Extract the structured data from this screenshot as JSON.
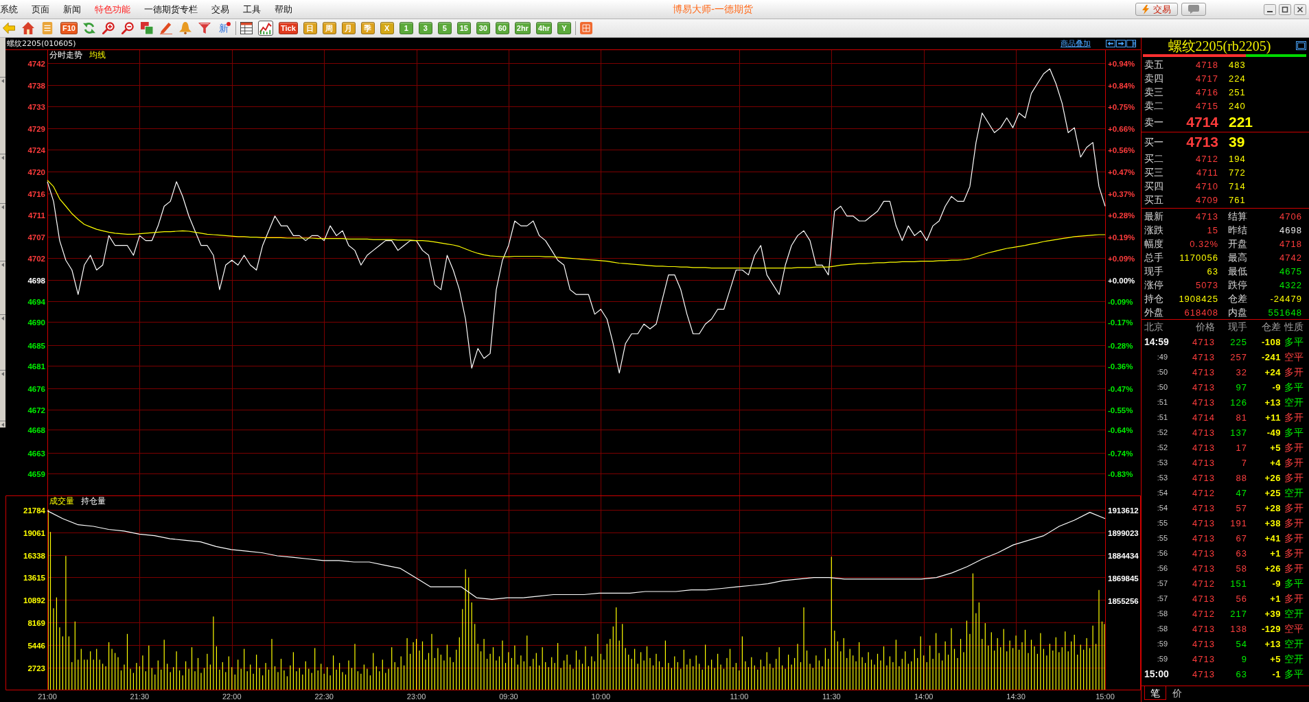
{
  "title_bar": {
    "menu": [
      {
        "label": "系统",
        "highlighted": false
      },
      {
        "label": "页面",
        "highlighted": false
      },
      {
        "label": "新闻",
        "highlighted": false
      },
      {
        "label": "特色功能",
        "highlighted": true
      },
      {
        "label": "一德期货专栏",
        "highlighted": false
      },
      {
        "label": "交易",
        "highlighted": false
      },
      {
        "label": "工具",
        "highlighted": false
      },
      {
        "label": "帮助",
        "highlighted": false
      }
    ],
    "title": "博易大师-一德期货",
    "buttons": [
      {
        "kind": "trade",
        "label": "交易"
      },
      {
        "kind": "chat"
      }
    ]
  },
  "toolbar": [
    {
      "kind": "icon",
      "selected": false
    },
    {
      "kind": "icon",
      "selected": false
    },
    {
      "kind": "icon",
      "selected": false
    },
    {
      "kind": "tile",
      "label": "F10",
      "color": "#e8581c",
      "selected": false
    },
    {
      "kind": "icon",
      "selected": false
    },
    {
      "kind": "icon",
      "selected": false
    },
    {
      "kind": "icon",
      "selected": false
    },
    {
      "kind": "icon",
      "selected": false
    },
    {
      "kind": "icon",
      "selected": false
    },
    {
      "kind": "icon",
      "selected": false
    },
    {
      "kind": "icon",
      "selected": false
    },
    {
      "kind": "news",
      "label": "新",
      "selected": false
    },
    {
      "kind": "separator"
    },
    {
      "kind": "icon",
      "selected": false
    },
    {
      "kind": "icon",
      "selected": true
    },
    {
      "kind": "tile",
      "label": "Tick",
      "color": "#e03a1e",
      "selected": false
    },
    {
      "kind": "tile",
      "label": "日",
      "color": "#dca21e",
      "selected": false
    },
    {
      "kind": "tile",
      "label": "周",
      "color": "#dca21e",
      "selected": false
    },
    {
      "kind": "tile",
      "label": "月",
      "color": "#dca21e",
      "selected": false
    },
    {
      "kind": "tile",
      "label": "季",
      "color": "#dca21e",
      "selected": false
    },
    {
      "kind": "tile",
      "label": "X",
      "color": "#d4a818",
      "selected": false
    },
    {
      "kind": "tile",
      "label": "1",
      "color": "#5caa3c",
      "selected": false
    },
    {
      "kind": "tile",
      "label": "3",
      "color": "#5caa3c",
      "selected": false
    },
    {
      "kind": "tile",
      "label": "5",
      "color": "#5caa3c",
      "selected": false
    },
    {
      "kind": "tile",
      "label": "15",
      "color": "#5caa3c",
      "selected": false
    },
    {
      "kind": "tile",
      "label": "30",
      "color": "#5caa3c",
      "selected": false
    },
    {
      "kind": "tile",
      "label": "60",
      "color": "#5caa3c",
      "selected": false
    },
    {
      "kind": "tile",
      "label": "2hr",
      "color": "#5caa3c",
      "selected": false
    },
    {
      "kind": "tile",
      "label": "4hr",
      "color": "#5caa3c",
      "selected": false
    },
    {
      "kind": "tile",
      "label": "Y",
      "color": "#5caa3c",
      "selected": false
    },
    {
      "kind": "separator"
    },
    {
      "kind": "icon",
      "selected": false
    }
  ],
  "chart_panel": {
    "instrument_label": "螺纹2205(010605)",
    "overlay_link": "商品叠加",
    "price_chart": {
      "percent_axis": [
        {
          "label": "+0.94%",
          "color": "#ff3c3c"
        },
        {
          "label": "+0.84%",
          "color": "#ff3c3c"
        },
        {
          "label": "+0.75%",
          "color": "#ff3c3c"
        },
        {
          "label": "+0.66%",
          "color": "#ff3c3c"
        },
        {
          "label": "+0.56%",
          "color": "#ff3c3c"
        },
        {
          "label": "+0.47%",
          "color": "#ff3c3c"
        },
        {
          "label": "+0.37%",
          "color": "#ff3c3c"
        },
        {
          "label": "+0.28%",
          "color": "#ff3c3c"
        },
        {
          "label": "+0.19%",
          "color": "#ff3c3c"
        },
        {
          "label": "+0.09%",
          "color": "#ff3c3c"
        },
        {
          "label": "+0.00%",
          "color": "#ffffff"
        },
        {
          "label": "-0.09%",
          "color": "#00ee00"
        },
        {
          "label": "-0.17%",
          "color": "#00ee00"
        },
        {
          "label": "-0.28%",
          "color": "#00ee00"
        },
        {
          "label": "-0.36%",
          "color": "#00ee00"
        },
        {
          "label": "-0.47%",
          "color": "#00ee00"
        },
        {
          "label": "-0.55%",
          "color": "#00ee00"
        },
        {
          "label": "-0.64%",
          "color": "#00ee00"
        },
        {
          "label": "-0.74%",
          "color": "#00ee00"
        },
        {
          "label": "-0.83%",
          "color": "#00ee00"
        }
      ],
      "chart_data": {
        "type": "line",
        "ylim": [
          4654.06,
          4744.96
        ],
        "grid": true,
        "yticks": [
          {
            "value": 4742.16,
            "label": "4742"
          },
          {
            "value": 4737.74,
            "label": "4738"
          },
          {
            "value": 4733.33,
            "label": "4733"
          },
          {
            "value": 4728.91,
            "label": "4729"
          },
          {
            "value": 4724.49,
            "label": "4724"
          },
          {
            "value": 4720.08,
            "label": "4720"
          },
          {
            "value": 4715.66,
            "label": "4716"
          },
          {
            "value": 4711.25,
            "label": "4711"
          },
          {
            "value": 4706.83,
            "label": "4707"
          },
          {
            "value": 4702.42,
            "label": "4702"
          },
          {
            "value": 4698,
            "label": "4698"
          },
          {
            "value": 4693.58,
            "label": "4694"
          },
          {
            "value": 4689.5,
            "label": "4690"
          },
          {
            "value": 4684.75,
            "label": "4685"
          },
          {
            "value": 4680.5,
            "label": "4681"
          },
          {
            "value": 4675.92,
            "label": "4676"
          },
          {
            "value": 4671.51,
            "label": "4672"
          },
          {
            "value": 4667.5,
            "label": "4668"
          },
          {
            "value": 4662.67,
            "label": "4663"
          },
          {
            "value": 4658.5,
            "label": "4659"
          }
        ],
        "series": [
          {
            "name": "分时走势",
            "color": "#ffffff",
            "values": [
              4718,
              4714,
              4706,
              4702,
              4700,
              4695,
              4701,
              4703,
              4700,
              4701,
              4707,
              4705,
              4705,
              4705,
              4703,
              4707,
              4706,
              4706,
              4709,
              4713,
              4714,
              4718,
              4715,
              4711,
              4708,
              4705,
              4705,
              4703,
              4696,
              4701,
              4702,
              4701,
              4703,
              4701,
              4700,
              4705,
              4708,
              4711,
              4709,
              4709,
              4707,
              4707,
              4706,
              4707,
              4707,
              4706,
              4709,
              4707,
              4708,
              4705,
              4704,
              4701,
              4703,
              4704,
              4705,
              4706,
              4706,
              4704,
              4705,
              4706,
              4706,
              4704,
              4703,
              4697,
              4696,
              4703,
              4700,
              4696,
              4690,
              4680,
              4684,
              4682,
              4683,
              4696,
              4702,
              4705,
              4710,
              4709,
              4709,
              4710,
              4707,
              4706,
              4704,
              4702,
              4701,
              4696,
              4695,
              4695,
              4695,
              4691,
              4692,
              4690,
              4685,
              4679,
              4685,
              4687,
              4687,
              4689,
              4688,
              4689,
              4694,
              4699,
              4699,
              4696,
              4691,
              4687,
              4687,
              4689,
              4690,
              4692,
              4692,
              4696,
              4700,
              4700,
              4699,
              4703,
              4705,
              4699,
              4697,
              4695,
              4701,
              4705,
              4707,
              4708,
              4706,
              4701,
              4701,
              4699,
              4712,
              4713,
              4711,
              4711,
              4710,
              4710,
              4711,
              4712,
              4714,
              4714,
              4709,
              4706,
              4709,
              4707,
              4708,
              4706,
              4709,
              4710,
              4713,
              4715,
              4714,
              4714,
              4717,
              4726,
              4732,
              4730,
              4728,
              4729,
              4731,
              4729,
              4732,
              4731,
              4736,
              4738,
              4740,
              4741,
              4738,
              4734,
              4728,
              4729,
              4723,
              4725,
              4726,
              4717,
              4713
            ]
          },
          {
            "name": "均线",
            "color": "#ffff00",
            "values": [
              4718.3,
              4717,
              4714.5,
              4713,
              4711.5,
              4710.3,
              4709.3,
              4708.8,
              4708.3,
              4708,
              4707.7,
              4707.5,
              4707.4,
              4707.3,
              4707.3,
              4707.4,
              4707.5,
              4707.6,
              4707.7,
              4707.8,
              4707.8,
              4707.9,
              4708,
              4707.9,
              4707.7,
              4707.5,
              4707.3,
              4707.2,
              4707.1,
              4707,
              4706.9,
              4706.8,
              4706.8,
              4706.7,
              4706.7,
              4706.6,
              4706.6,
              4706.6,
              4706.6,
              4706.5,
              4706.5,
              4706.5,
              4706.5,
              4706.5,
              4706.4,
              4706.4,
              4706.4,
              4706.4,
              4706.4,
              4706.3,
              4706.3,
              4706.3,
              4706.3,
              4706.2,
              4706.2,
              4706.2,
              4706.2,
              4706.1,
              4706.1,
              4706.1,
              4706,
              4706,
              4705.9,
              4705.7,
              4705.5,
              4705.3,
              4705.1,
              4704.8,
              4704.3,
              4703.8,
              4703.4,
              4703.1,
              4702.9,
              4702.8,
              4702.7,
              4702.7,
              4702.8,
              4702.8,
              4702.8,
              4702.8,
              4702.8,
              4702.7,
              4702.7,
              4702.6,
              4702.5,
              4702.4,
              4702.3,
              4702.2,
              4702.1,
              4702,
              4701.9,
              4701.8,
              4701.6,
              4701.4,
              4701.3,
              4701.2,
              4701.1,
              4701,
              4700.9,
              4700.8,
              4700.8,
              4700.7,
              4700.7,
              4700.6,
              4700.6,
              4700.5,
              4700.5,
              4700.5,
              4700.4,
              4700.4,
              4700.4,
              4700.4,
              4700.4,
              4700.4,
              4700.4,
              4700.4,
              4700.4,
              4700.4,
              4700.4,
              4700.4,
              4700.4,
              4700.4,
              4700.5,
              4700.5,
              4700.5,
              4700.6,
              4700.6,
              4700.6,
              4700.8,
              4701,
              4701.1,
              4701.2,
              4701.3,
              4701.3,
              4701.4,
              4701.5,
              4701.5,
              4701.6,
              4701.6,
              4701.7,
              4701.7,
              4701.7,
              4701.8,
              4701.8,
              4701.8,
              4701.9,
              4701.9,
              4702,
              4702,
              4702.1,
              4702.3,
              4702.7,
              4703.1,
              4703.5,
              4703.8,
              4704.1,
              4704.4,
              4704.6,
              4704.8,
              4705,
              4705.3,
              4705.5,
              4705.8,
              4706,
              4706.2,
              4706.4,
              4706.6,
              4706.8,
              4706.9,
              4707,
              4707.1,
              4707.2,
              4707.2
            ]
          }
        ]
      }
    },
    "volume_chart": {
      "chart_data": {
        "type": "bar",
        "categories": [
          "21:00",
          null,
          null,
          null,
          null,
          null,
          null,
          null,
          null,
          null,
          null,
          null,
          null,
          null,
          null,
          null,
          null,
          null,
          null,
          null,
          null,
          null,
          null,
          null,
          null,
          null,
          null,
          null,
          null,
          null,
          "21:30",
          null,
          null,
          null,
          null,
          null,
          null,
          null,
          null,
          null,
          null,
          null,
          null,
          null,
          null,
          null,
          null,
          null,
          null,
          null,
          null,
          null,
          null,
          null,
          null,
          null,
          null,
          null,
          null,
          null,
          "22:00",
          null,
          null,
          null,
          null,
          null,
          null,
          null,
          null,
          null,
          null,
          null,
          null,
          null,
          null,
          null,
          null,
          null,
          null,
          null,
          null,
          null,
          null,
          null,
          null,
          null,
          null,
          null,
          null,
          null,
          "22:30",
          null,
          null,
          null,
          null,
          null,
          null,
          null,
          null,
          null,
          null,
          null,
          null,
          null,
          null,
          null,
          null,
          null,
          null,
          null,
          null,
          null,
          null,
          null,
          null,
          null,
          null,
          null,
          null,
          null,
          "23:00",
          null,
          null,
          null,
          null,
          null,
          null,
          null,
          null,
          null,
          null,
          null,
          null,
          null,
          null,
          null,
          null,
          null,
          null,
          null,
          null,
          null,
          null,
          null,
          null,
          null,
          null,
          null,
          null,
          null,
          "09:30",
          null,
          null,
          null,
          null,
          null,
          null,
          null,
          null,
          null,
          null,
          null,
          null,
          null,
          null,
          null,
          null,
          null,
          null,
          null,
          null,
          null,
          null,
          null,
          null,
          null,
          null,
          null,
          null,
          null,
          "10:00",
          null,
          null,
          null,
          null,
          null,
          null,
          null,
          null,
          null,
          null,
          null,
          null,
          null,
          null,
          null,
          null,
          null,
          null,
          null,
          null,
          null,
          null,
          null,
          null,
          null,
          null,
          null,
          null,
          null,
          null,
          null,
          null,
          null,
          null,
          null,
          null,
          null,
          null,
          null,
          null,
          null,
          null,
          null,
          null,
          "11:00",
          null,
          null,
          null,
          null,
          null,
          null,
          null,
          null,
          null,
          null,
          null,
          null,
          null,
          null,
          null,
          null,
          null,
          null,
          null,
          null,
          null,
          null,
          null,
          null,
          null,
          null,
          null,
          null,
          null,
          "11:30",
          null,
          null,
          null,
          null,
          null,
          null,
          null,
          null,
          null,
          null,
          null,
          null,
          null,
          null,
          null,
          null,
          null,
          null,
          null,
          null,
          null,
          null,
          null,
          null,
          null,
          null,
          null,
          null,
          null,
          "14:00",
          null,
          null,
          null,
          null,
          null,
          null,
          null,
          null,
          null,
          null,
          null,
          null,
          null,
          null,
          null,
          null,
          null,
          null,
          null,
          null,
          null,
          null,
          null,
          null,
          null,
          null,
          null,
          null,
          null,
          "14:30",
          null,
          null,
          null,
          null,
          null,
          null,
          null,
          null,
          null,
          null,
          null,
          null,
          null,
          null,
          null,
          null,
          null,
          null,
          null,
          null,
          null,
          null,
          null,
          null,
          null,
          null,
          null,
          null,
          "15:00"
        ],
        "ylim": [
          0,
          23500
        ],
        "grid": true,
        "yticks": [
          21784,
          19061,
          16338,
          13615,
          10892,
          8169,
          5446,
          2723
        ],
        "series": [
          {
            "name": "成交量",
            "color": "#ffff00",
            "values": [
              21800,
              19100,
              9900,
              11200,
              7600,
              6500,
              16200,
              6500,
              3400,
              8300,
              3700,
              5000,
              3700,
              3700,
              4700,
              3700,
              5000,
              3700,
              3200,
              2900,
              5800,
              5000,
              4500,
              4000,
              2400,
              3100,
              6800,
              2600,
              2100,
              3300,
              2900,
              4200,
              2300,
              5400,
              2700,
              1900,
              3600,
              2500,
              6100,
              3200,
              2200,
              2800,
              4700,
              2400,
              1800,
              3500,
              2600,
              5200,
              2300,
              3900,
              2100,
              2700,
              4400,
              3100,
              8900,
              5300,
              2500,
              3400,
              2200,
              4100,
              2800,
              1900,
              3700,
              2600,
              5000,
              2300,
              3100,
              2000,
              4300,
              2700,
              1800,
              3300,
              2500,
              6200,
              2900,
              2200,
              3800,
              2400,
              1700,
              3000,
              4600,
              2300,
              2700,
              1900,
              3500,
              2600,
              2100,
              5100,
              2400,
              3200,
              2000,
              2800,
              1800,
              4200,
              2500,
              3300,
              2200,
              1900,
              3600,
              2700,
              5600,
              2300,
              2000,
              3100,
              2600,
              1800,
              4500,
              2900,
              2300,
              3700,
              2100,
              2600,
              5200,
              3400,
              2800,
              4100,
              3000,
              6300,
              4400,
              5800,
              6200,
              4800,
              5900,
              3700,
              4500,
              6800,
              3900,
              5100,
              4300,
              3600,
              5500,
              4000,
              3400,
              4900,
              6400,
              9800,
              14600,
              13600,
              10600,
              8000,
              5600,
              4700,
              6200,
              3800,
              4400,
              5200,
              3600,
              4100,
              6000,
              3300,
              4600,
              3900,
              5400,
              3100,
              4200,
              3500,
              6600,
              2900,
              3800,
              4500,
              3000,
              5200,
              3400,
              2800,
              4000,
              3300,
              5700,
              2700,
              3600,
              4300,
              3100,
              2600,
              4800,
              3700,
              3200,
              5300,
              2900,
              4100,
              3500,
              6800,
              4400,
              3700,
              5600,
              6200,
              7700,
              10000,
              6000,
              8000,
              5100,
              4300,
              3800,
              5000,
              3200,
              4600,
              3600,
              5300,
              3900,
              3000,
              4400,
              3500,
              2800,
              6000,
              3300,
              2700,
              4100,
              3400,
              2600,
              4900,
              3100,
              3800,
              2900,
              4200,
              3200,
              2500,
              5500,
              3000,
              3700,
              2700,
              4400,
              3100,
              2600,
              3900,
              5000,
              2800,
              3300,
              2400,
              6500,
              3500,
              2800,
              4000,
              3000,
              2500,
              3700,
              2900,
              4600,
              3200,
              2700,
              3800,
              5200,
              3000,
              2600,
              4300,
              3100,
              3900,
              5600,
              3400,
              10000,
              4800,
              3200,
              2700,
              4200,
              3600,
              2900,
              5100,
              3800,
              16100,
              7200,
              5900,
              4700,
              6300,
              3900,
              5000,
              4200,
              3500,
              5800,
              4000,
              3300,
              4600,
              3700,
              3100,
              4400,
              3600,
              5300,
              3000,
              4100,
              3400,
              6100,
              2900,
              3800,
              4700,
              3200,
              3500,
              5000,
              3900,
              6500,
              4200,
              3400,
              5400,
              3800,
              6900,
              4500,
              3600,
              5900,
              4300,
              7500,
              5000,
              3900,
              6200,
              4600,
              8400,
              6800,
              14100,
              9300,
              10600,
              6200,
              8100,
              5400,
              7000,
              4800,
              6300,
              5200,
              7400,
              4700,
              6000,
              5100,
              6600,
              4900,
              5800,
              7300,
              4500,
              6100,
              5300,
              4400,
              6900,
              5000,
              4200,
              5600,
              4800,
              6400,
              4600,
              5200,
              7100,
              4700,
              5900,
              6700,
              4300,
              5500,
              4900,
              6300,
              5100,
              7800,
              5600,
              12100,
              8300,
              8000
            ]
          }
        ]
      }
    },
    "open_interest_chart": {
      "chart_data": {
        "type": "line",
        "ylim": [
          1797340,
          1922896
        ],
        "yticks": [
          1913612,
          1899023,
          1884434,
          1869845,
          1855256
        ],
        "series": [
          {
            "name": "持仓量",
            "color": "#ffffff",
            "values": [
              1913000,
              1908000,
              1904000,
              1903000,
              1901000,
              1900000,
              1898000,
              1897000,
              1895000,
              1894000,
              1893000,
              1890000,
              1888000,
              1887000,
              1886000,
              1884000,
              1883000,
              1882000,
              1881000,
              1881000,
              1880000,
              1880000,
              1878000,
              1876000,
              1870000,
              1864000,
              1864000,
              1864000,
              1857000,
              1856000,
              1857000,
              1857000,
              1858000,
              1859000,
              1859000,
              1859000,
              1860000,
              1860000,
              1860000,
              1861000,
              1861000,
              1861000,
              1862000,
              1862000,
              1863000,
              1864000,
              1865000,
              1866000,
              1868000,
              1869000,
              1870000,
              1870000,
              1869000,
              1869000,
              1869000,
              1869000,
              1869000,
              1869000,
              1870000,
              1873000,
              1877000,
              1882000,
              1886000,
              1891000,
              1894000,
              1897000,
              1903000,
              1907000,
              1912000,
              1908000
            ]
          }
        ]
      }
    }
  },
  "quote_panel": {
    "title": "螺纹2205(rb2205)",
    "ratio_bar": {
      "level": 0.63
    },
    "asks": [
      {
        "label": "卖五",
        "price": "4718",
        "volume": "483",
        "kind": "depth"
      },
      {
        "label": "卖四",
        "price": "4717",
        "volume": "224",
        "kind": "depth"
      },
      {
        "label": "卖三",
        "price": "4716",
        "volume": "251",
        "kind": "depth"
      },
      {
        "label": "卖二",
        "price": "4715",
        "volume": "240",
        "kind": "depth"
      },
      {
        "label": "卖一",
        "price": "4714",
        "volume": "221",
        "kind": "best"
      }
    ],
    "bids": [
      {
        "label": "买一",
        "price": "4713",
        "volume": "39",
        "kind": "best"
      },
      {
        "label": "买二",
        "price": "4712",
        "volume": "194",
        "kind": "depth"
      },
      {
        "label": "买三",
        "price": "4711",
        "volume": "772",
        "kind": "depth"
      },
      {
        "label": "买四",
        "price": "4710",
        "volume": "714",
        "kind": "depth"
      },
      {
        "label": "买五",
        "price": "4709",
        "volume": "761",
        "kind": "depth"
      }
    ],
    "stats": [
      {
        "label": "最新",
        "value": "4713",
        "color": "#ff3c3c"
      },
      {
        "label": "结算",
        "value": "4706",
        "color": "#ff3c3c"
      },
      {
        "label": "涨跌",
        "value": "15",
        "color": "#ff3c3c"
      },
      {
        "label": "昨结",
        "value": "4698",
        "color": "#e8e8e8"
      },
      {
        "label": "幅度",
        "value": "0.32%",
        "color": "#ff3c3c"
      },
      {
        "label": "开盘",
        "value": "4718",
        "color": "#ff3c3c"
      },
      {
        "label": "总手",
        "value": "1170056",
        "color": "#ffff00"
      },
      {
        "label": "最高",
        "value": "4742",
        "color": "#ff3c3c"
      },
      {
        "label": "现手",
        "value": "63",
        "color": "#ffff00"
      },
      {
        "label": "最低",
        "value": "4675",
        "color": "#00ee00"
      },
      {
        "label": "涨停",
        "value": "5073",
        "color": "#ff3c3c"
      },
      {
        "label": "跌停",
        "value": "4322",
        "color": "#00ee00"
      },
      {
        "label": "持仓",
        "value": "1908425",
        "color": "#ffff00"
      },
      {
        "label": "仓差",
        "value": "-24479",
        "color": "#ffff00"
      },
      {
        "label": "外盘",
        "value": "618408",
        "color": "#ff3c3c"
      },
      {
        "label": "内盘",
        "value": "551648",
        "color": "#00ee00"
      }
    ],
    "trades": {
      "columns": [
        "北京",
        "价格",
        "现手",
        "仓差",
        "性质"
      ],
      "rows": [
        {
          "time": "14:59",
          "price": "4713",
          "volume": "225",
          "oi_change": "-108",
          "nature": "多平",
          "color": "#00ee00",
          "kind": "minute"
        },
        {
          "time": ":49",
          "price": "4713",
          "volume": "257",
          "oi_change": "-241",
          "nature": "空平",
          "color": "#ff4040",
          "kind": "tick"
        },
        {
          "time": ":50",
          "price": "4713",
          "volume": "32",
          "oi_change": "+24",
          "nature": "多开",
          "color": "#ff4040",
          "kind": "tick"
        },
        {
          "time": ":50",
          "price": "4713",
          "volume": "97",
          "oi_change": "-9",
          "nature": "多平",
          "color": "#00ee00",
          "kind": "tick"
        },
        {
          "time": ":51",
          "price": "4713",
          "volume": "126",
          "oi_change": "+13",
          "nature": "空开",
          "color": "#00ee00",
          "kind": "tick"
        },
        {
          "time": ":51",
          "price": "4714",
          "volume": "81",
          "oi_change": "+11",
          "nature": "多开",
          "color": "#ff4040",
          "kind": "tick"
        },
        {
          "time": ":52",
          "price": "4713",
          "volume": "137",
          "oi_change": "-49",
          "nature": "多平",
          "color": "#00ee00",
          "kind": "tick"
        },
        {
          "time": ":52",
          "price": "4713",
          "volume": "17",
          "oi_change": "+5",
          "nature": "多开",
          "color": "#ff4040",
          "kind": "tick"
        },
        {
          "time": ":53",
          "price": "4713",
          "volume": "7",
          "oi_change": "+4",
          "nature": "多开",
          "color": "#ff4040",
          "kind": "tick"
        },
        {
          "time": ":53",
          "price": "4713",
          "volume": "88",
          "oi_change": "+26",
          "nature": "多开",
          "color": "#ff4040",
          "kind": "tick"
        },
        {
          "time": ":54",
          "price": "4712",
          "volume": "47",
          "oi_change": "+25",
          "nature": "空开",
          "color": "#00ee00",
          "kind": "tick"
        },
        {
          "time": ":54",
          "price": "4713",
          "volume": "57",
          "oi_change": "+28",
          "nature": "多开",
          "color": "#ff4040",
          "kind": "tick"
        },
        {
          "time": ":55",
          "price": "4713",
          "volume": "191",
          "oi_change": "+38",
          "nature": "多开",
          "color": "#ff4040",
          "kind": "tick"
        },
        {
          "time": ":55",
          "price": "4713",
          "volume": "67",
          "oi_change": "+41",
          "nature": "多开",
          "color": "#ff4040",
          "kind": "tick"
        },
        {
          "time": ":56",
          "price": "4713",
          "volume": "63",
          "oi_change": "+1",
          "nature": "多开",
          "color": "#ff4040",
          "kind": "tick"
        },
        {
          "time": ":56",
          "price": "4713",
          "volume": "58",
          "oi_change": "+26",
          "nature": "多开",
          "color": "#ff4040",
          "kind": "tick"
        },
        {
          "time": ":57",
          "price": "4712",
          "volume": "151",
          "oi_change": "-9",
          "nature": "多平",
          "color": "#00ee00",
          "kind": "tick"
        },
        {
          "time": ":57",
          "price": "4713",
          "volume": "56",
          "oi_change": "+1",
          "nature": "多开",
          "color": "#ff4040",
          "kind": "tick"
        },
        {
          "time": ":58",
          "price": "4712",
          "volume": "217",
          "oi_change": "+39",
          "nature": "空开",
          "color": "#00ee00",
          "kind": "tick"
        },
        {
          "time": ":58",
          "price": "4713",
          "volume": "138",
          "oi_change": "-129",
          "nature": "空平",
          "color": "#ff4040",
          "kind": "tick"
        },
        {
          "time": ":59",
          "price": "4713",
          "volume": "54",
          "oi_change": "+13",
          "nature": "空开",
          "color": "#00ee00",
          "kind": "tick"
        },
        {
          "time": ":59",
          "price": "4713",
          "volume": "9",
          "oi_change": "+5",
          "nature": "空开",
          "color": "#00ee00",
          "kind": "tick"
        },
        {
          "time": "15:00",
          "price": "4713",
          "volume": "63",
          "oi_change": "-1",
          "nature": "多平",
          "color": "#00ee00",
          "kind": "minute"
        }
      ]
    },
    "tabs": [
      {
        "label": "笔",
        "selected": true
      },
      {
        "label": "价",
        "selected": false
      }
    ]
  }
}
